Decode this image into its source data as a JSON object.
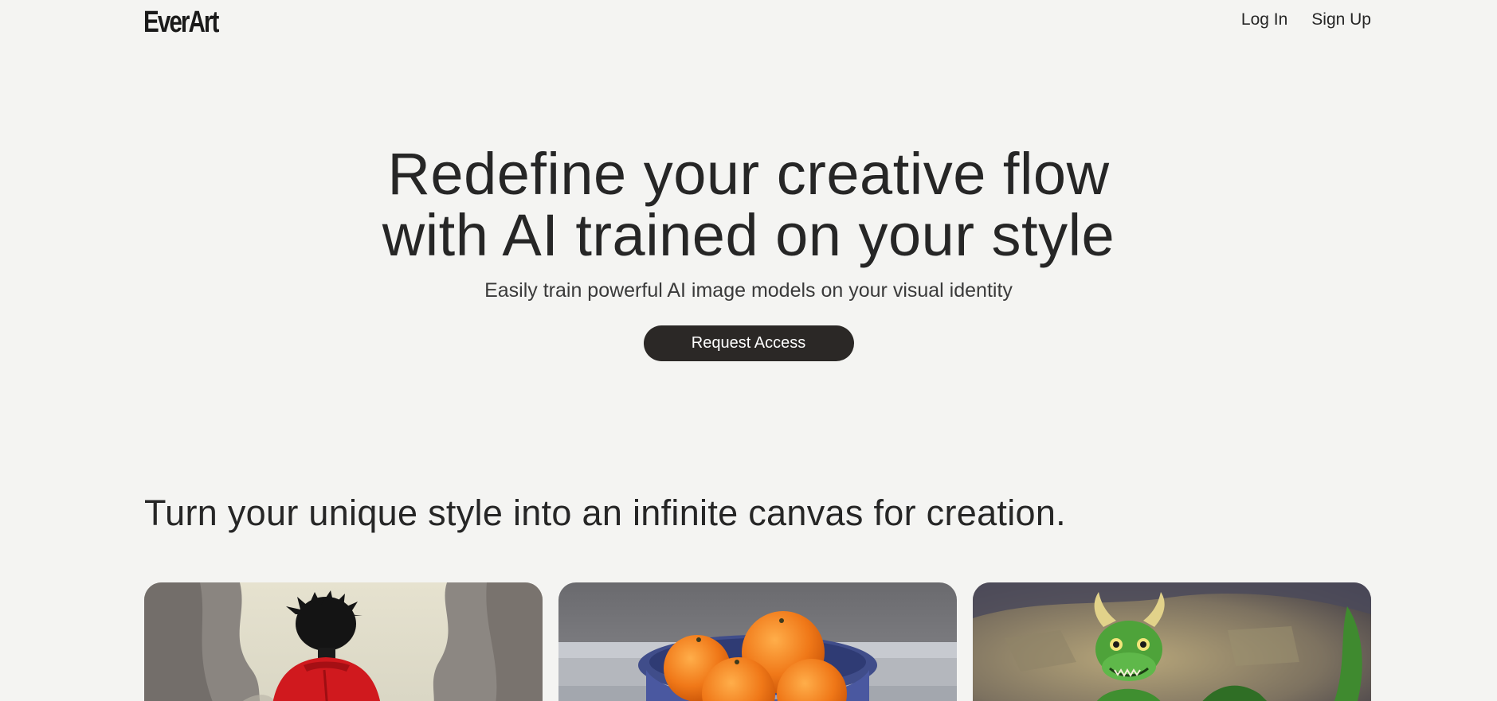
{
  "header": {
    "logo": "EverArt",
    "nav": {
      "login": "Log In",
      "signup": "Sign Up"
    }
  },
  "hero": {
    "title_line1": "Redefine your creative flow",
    "title_line2": "with AI trained on your style",
    "subtitle": "Easily train powerful AI image models on your visual identity",
    "cta_label": "Request Access"
  },
  "section": {
    "title": "Turn your unique style into an infinite canvas for creation."
  },
  "gallery": {
    "cards": [
      {
        "subject": "anime character in red jacket between cliffs"
      },
      {
        "subject": "bowl of oranges still life"
      },
      {
        "subject": "green dragon in stone cave"
      }
    ]
  },
  "colors": {
    "background": "#f4f4f2",
    "text": "#262626",
    "button": "#2b2826",
    "button_text": "#ffffff"
  }
}
